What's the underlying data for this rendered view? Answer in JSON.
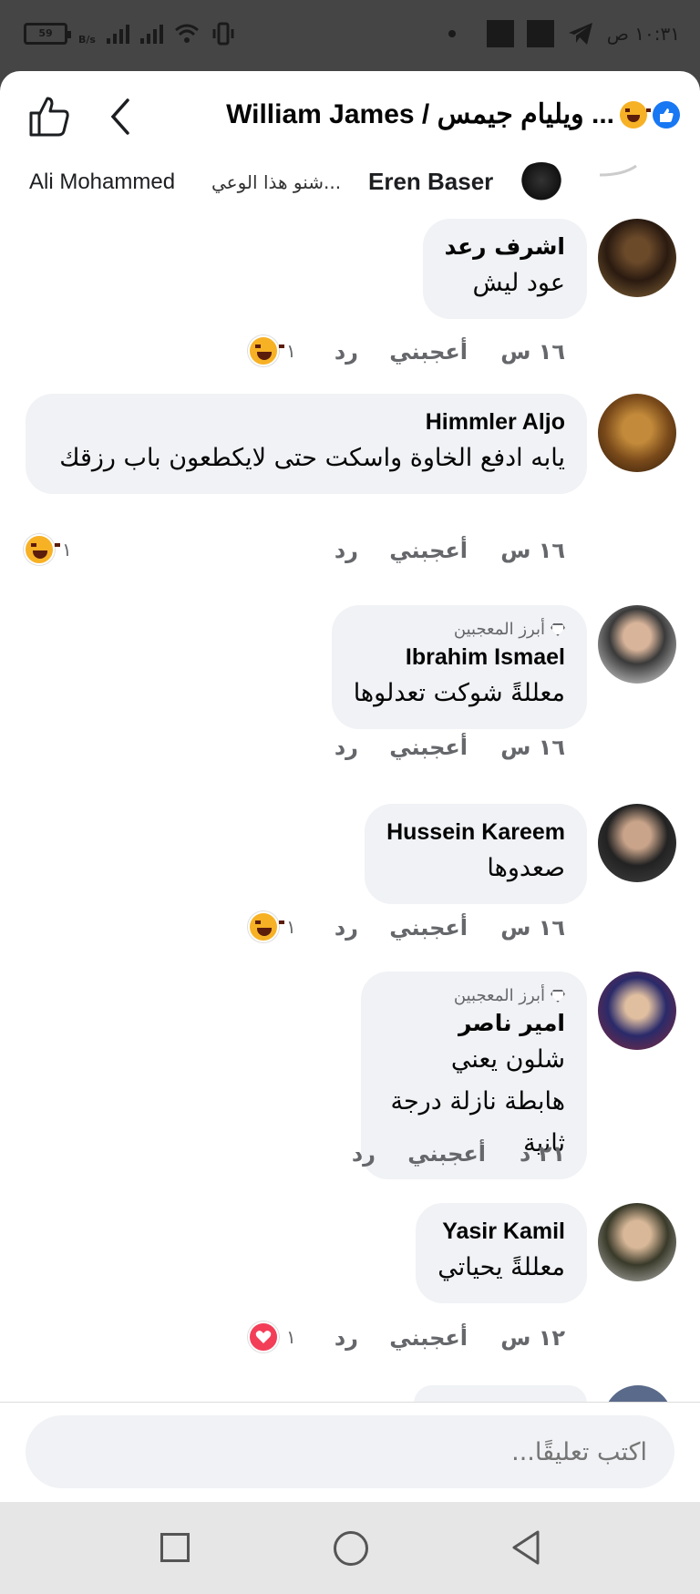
{
  "status_bar": {
    "battery": "59",
    "speed_unit": "B/s",
    "time": "١٠:٣١ ص"
  },
  "header": {
    "title": "William James / ويليام جيمس ..."
  },
  "seen_by": {
    "name1": "Ali Mohammed",
    "preview": "شنو هذا الوعي...",
    "name2": "Eren Baser"
  },
  "comments": [
    {
      "name": "اشرف رعد",
      "text": "عود ليش",
      "time": "١٦ س",
      "like_label": "أعجبني",
      "reply_label": "رد",
      "reaction_count": "١",
      "reaction": "haha"
    },
    {
      "name": "Himmler Aljo",
      "text": "يابه ادفع الخاوة واسكت حتى لايكطعون باب رزقك",
      "time": "١٦ س",
      "like_label": "أعجبني",
      "reply_label": "رد",
      "reaction_count": "١",
      "reaction": "haha"
    },
    {
      "badge": "أبرز المعجبين",
      "name": "Ibrahim Ismael",
      "text": "معللةً شوكت تعدلوها",
      "time": "١٦ س",
      "like_label": "أعجبني",
      "reply_label": "رد"
    },
    {
      "name": "Hussein Kareem",
      "text": "صعدوها",
      "time": "١٦ س",
      "like_label": "أعجبني",
      "reply_label": "رد",
      "reaction_count": "١",
      "reaction": "haha"
    },
    {
      "badge": "أبرز المعجبين",
      "name": "امير ناصر",
      "text": "شلون يعني هابطة نازلة درجة ثانية",
      "time": "٢١ د",
      "like_label": "أعجبني",
      "reply_label": "رد"
    },
    {
      "name": "Yasir Kamil",
      "text": "معللةً يحياتي",
      "time": "١٢ س",
      "like_label": "أعجبني",
      "reply_label": "رد",
      "reaction_count": "١",
      "reaction": "love"
    }
  ],
  "composer": {
    "placeholder": "اكتب تعليقًا..."
  }
}
